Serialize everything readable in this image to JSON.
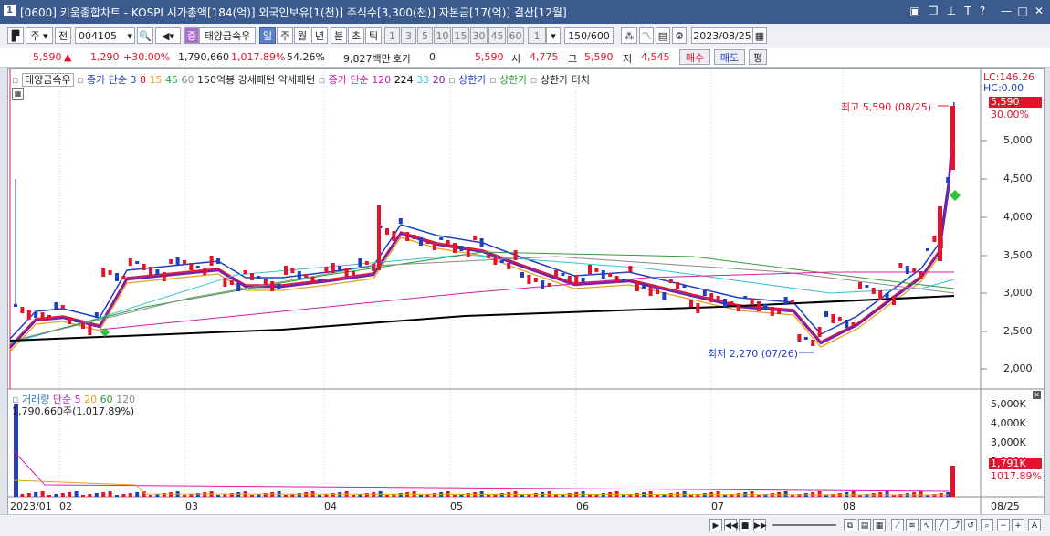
{
  "window": {
    "title": "[0600] 키움종합차트 - KOSPI 시가총액[184(억)] 외국인보유[1(천)] 주식수[3,300(천)] 자본금[17(억)] 결산[12월]",
    "icon_label": "1"
  },
  "toolbar": {
    "period_select": "주",
    "full_label": "전",
    "code_value": "004105",
    "stock_name": "태양금속우",
    "period_day": "일",
    "period_week": "주",
    "period_month": "월",
    "period_year": "년",
    "period_min": "분",
    "period_sec": "초",
    "period_tick": "틱",
    "intervals": [
      "1",
      "3",
      "5",
      "10",
      "15",
      "30",
      "45",
      "60"
    ],
    "interval_select": "1",
    "count_value": "150",
    "count_total": "/600",
    "date_value": "2023/08/25"
  },
  "pricebar": {
    "price": "5,590",
    "change": "1,290",
    "change_pct": "+30.00%",
    "volume": "1,790,660",
    "volume_pct": "1,017.89%",
    "turnover_pct": "54.26%",
    "amount": "9,827백만",
    "quote_label": "호가",
    "quote_value": "0",
    "quote_price": "5,590",
    "open_label": "시",
    "open": "4,775",
    "high_label": "고",
    "high": "5,590",
    "low_label": "저",
    "low": "4,545",
    "buy_label": "매수",
    "sell_label": "매도",
    "eval_label": "평"
  },
  "legend_top": {
    "name": "태양금속우",
    "ma_label": "종가 단순",
    "ma_periods": [
      {
        "text": "3",
        "color": "#1f3ec2"
      },
      {
        "text": "8",
        "color": "#e0142c"
      },
      {
        "text": "15",
        "color": "#e6a21a"
      },
      {
        "text": "45",
        "color": "#2a9d3a"
      },
      {
        "text": "60",
        "color": "#888888"
      }
    ],
    "pattern1": "150억봉 강세패턴",
    "pattern2": "약세패턴",
    "ma2_label": "종가 단순",
    "ma2_periods": [
      {
        "text": "120",
        "color": "#d81bb0"
      },
      {
        "text": "224",
        "color": "#000000"
      },
      {
        "text": "33",
        "color": "#2fc4d4"
      },
      {
        "text": "20",
        "color": "#7a1fa8"
      }
    ],
    "upper_limit": "상한가",
    "upper_limit2": "상한가",
    "upper_touch": "상한가 터치",
    "lc": "LC:146.26",
    "hc": "HC:0.00"
  },
  "annotations": {
    "high_note": "최고 5,590 (08/25)",
    "low_note": "최저 2,270 (07/26)"
  },
  "price_axis": {
    "ticks": [
      "5,000",
      "4,500",
      "4,000",
      "3,500",
      "3,000",
      "2,500",
      "2,000"
    ],
    "current_label": "5,590",
    "current_pct": "30.00%"
  },
  "legend_bottom": {
    "name": "거래량",
    "ma_label": "단순",
    "periods": [
      {
        "text": "5",
        "color": "#d81bb0"
      },
      {
        "text": "20",
        "color": "#e6a21a"
      },
      {
        "text": "60",
        "color": "#2a9d3a"
      },
      {
        "text": "120",
        "color": "#888888"
      }
    ],
    "value_line": "1,790,660주(1,017.89%)"
  },
  "volume_axis": {
    "ticks": [
      "5,000K",
      "4,000K",
      "3,000K",
      "2,000K"
    ],
    "current_label": "1,791K",
    "current_pct": "1017.89%"
  },
  "date_axis": {
    "labels": [
      "2023/01",
      "02",
      "03",
      "04",
      "05",
      "06",
      "07",
      "08"
    ],
    "end_label": "08/25"
  },
  "colors": {
    "up": "#e0142c",
    "down": "#1f3ec2",
    "titlebar": "#3b5b8f"
  }
}
